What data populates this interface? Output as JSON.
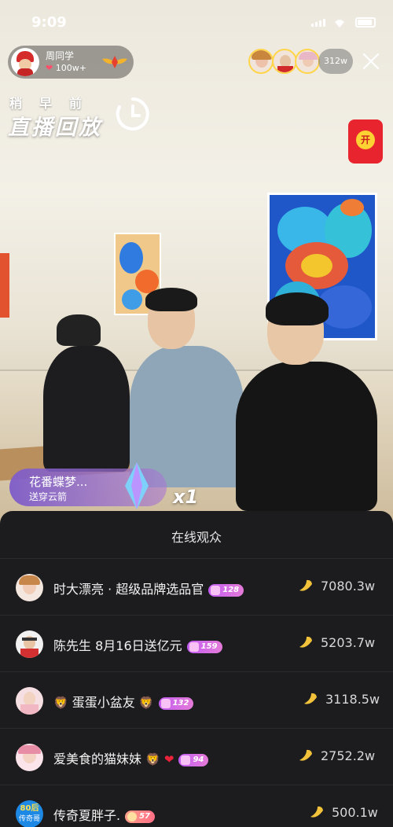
{
  "status": {
    "time": "9:09"
  },
  "host": {
    "name": "周同学",
    "likes": "100w+"
  },
  "top_viewers": {
    "count": "312w"
  },
  "replay": {
    "subtitle": "稍早前",
    "title": "直播回放"
  },
  "red_envelope": {
    "label": "开"
  },
  "gift": {
    "sender": "花番蝶梦...",
    "text": "送穿云箭",
    "count": "x1"
  },
  "audience": {
    "title": "在线观众",
    "rows": [
      {
        "name": "时大漂亮 · 超级品牌选品官",
        "level": "128",
        "score": "7080.3w"
      },
      {
        "name": "陈先生 8月16日送亿元",
        "level": "159",
        "score": "5203.7w"
      },
      {
        "name": "蛋蛋小盆友",
        "level": "132",
        "score": "3118.5w"
      },
      {
        "name": "爱美食的猫妹妹",
        "level": "94",
        "score": "2752.2w"
      },
      {
        "name": "传奇夏胖子.",
        "level": "57",
        "score": "500.1w"
      }
    ],
    "row5_avatar_text": {
      "top": "80后",
      "bottom": "传奇哥"
    }
  },
  "colors": {
    "sheet_bg": "#1c1c1e",
    "level_badge": "#c35df2",
    "envelope": "#e8242f",
    "gift_toast": "#7e5cc9"
  }
}
